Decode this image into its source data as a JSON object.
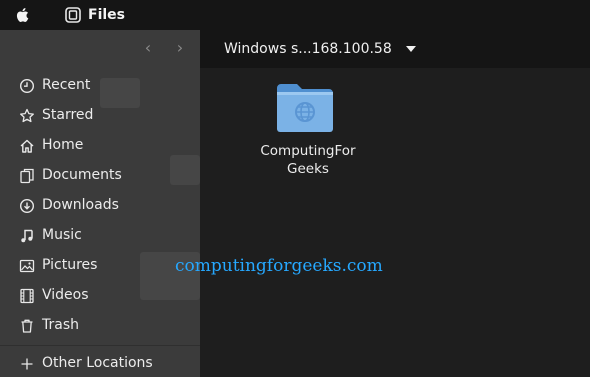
{
  "topbar": {
    "app_icon": "files-app-icon",
    "app_name": "Files"
  },
  "sidebar": {
    "items": [
      {
        "label": "Recent",
        "icon": "clock-icon"
      },
      {
        "label": "Starred",
        "icon": "star-icon"
      },
      {
        "label": "Home",
        "icon": "home-icon"
      },
      {
        "label": "Documents",
        "icon": "document-icon"
      },
      {
        "label": "Downloads",
        "icon": "download-icon"
      },
      {
        "label": "Music",
        "icon": "music-note-icon"
      },
      {
        "label": "Pictures",
        "icon": "picture-icon"
      },
      {
        "label": "Videos",
        "icon": "film-icon"
      },
      {
        "label": "Trash",
        "icon": "trash-icon"
      },
      {
        "label": "Other Locations",
        "icon": "plus-icon"
      }
    ]
  },
  "pathbar": {
    "location": "Windows s...168.100.58"
  },
  "files": [
    {
      "name_line1": "ComputingFor",
      "name_line2": "Geeks",
      "icon": "network-folder-icon"
    }
  ],
  "watermark": "computingforgeeks.com",
  "colors": {
    "sidebar_bg": "#3b3b3b",
    "main_bg": "#1e1e1e",
    "topbar_bg": "#151515",
    "folder_blue": "#7bb2e6",
    "watermark_blue": "#26a8ff"
  }
}
